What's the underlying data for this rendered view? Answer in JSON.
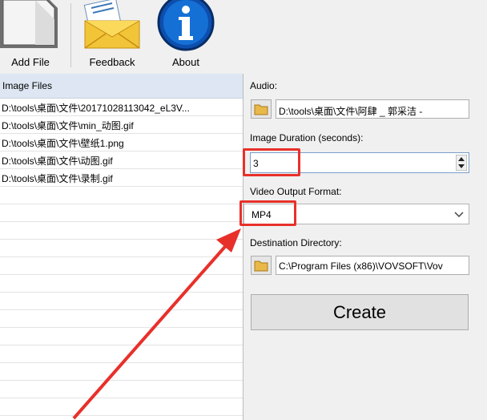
{
  "toolbar": {
    "add_file_label": "Add File",
    "feedback_label": "Feedback",
    "about_label": "About"
  },
  "image_files": {
    "header": "Image Files",
    "items": [
      "D:\\tools\\桌面\\文件\\20171028113042_eL3V...",
      "D:\\tools\\桌面\\文件\\min_动图.gif",
      "D:\\tools\\桌面\\文件\\壁纸1.png",
      "D:\\tools\\桌面\\文件\\动图.gif",
      "D:\\tools\\桌面\\文件\\录制.gif"
    ]
  },
  "audio": {
    "label": "Audio:",
    "path": "D:\\tools\\桌面\\文件\\阿肆 _ 郭采洁 -"
  },
  "image_duration": {
    "label": "Image Duration (seconds):",
    "value": "3"
  },
  "video_format": {
    "label": "Video Output Format:",
    "selected": "MP4"
  },
  "destination": {
    "label": "Destination Directory:",
    "path": "C:\\Program Files (x86)\\VOVSOFT\\Vov"
  },
  "create_label": "Create",
  "colors": {
    "highlight": "#e8302a",
    "list_header_bg": "#dde6f2"
  }
}
